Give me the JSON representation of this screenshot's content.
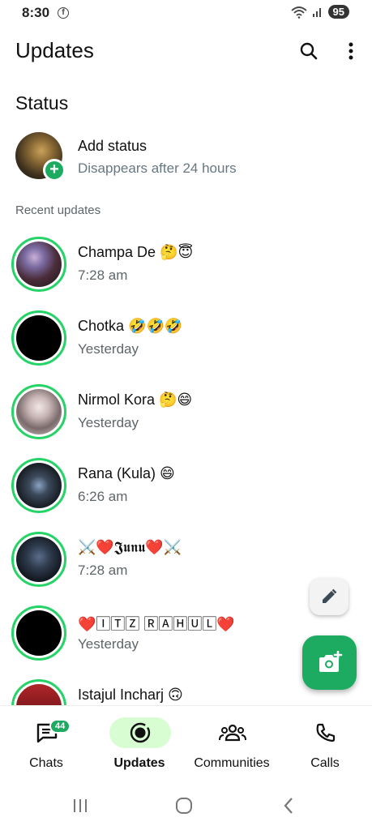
{
  "status_bar": {
    "time": "8:30",
    "app_icon": "facebook-icon",
    "battery": "95"
  },
  "header": {
    "title": "Updates"
  },
  "status_section": {
    "title": "Status",
    "my_status": {
      "title": "Add status",
      "subtitle": "Disappears after 24 hours"
    }
  },
  "recent": {
    "label": "Recent updates",
    "items": [
      {
        "name": "Champa De 🤔😇",
        "time": "7:28 am"
      },
      {
        "name": "Chotka 🤣🤣🤣",
        "time": "Yesterday"
      },
      {
        "name": "Nirmol Kora 🤔😄",
        "time": "Yesterday"
      },
      {
        "name": "Rana (Kula) 😄",
        "time": "6:26 am"
      },
      {
        "name": "⚔️❤️𝕵𝖚𝖓𝖚❤️⚔️",
        "time": "7:28 am"
      },
      {
        "name": "❤️🄸🅃🅉 🅁🄰🄷🅄🄻❤️",
        "time": "Yesterday"
      },
      {
        "name": "Istajul Incharj 🙃",
        "time": ""
      }
    ]
  },
  "nav": {
    "tabs": [
      {
        "label": "Chats",
        "badge": "44"
      },
      {
        "label": "Updates"
      },
      {
        "label": "Communities"
      },
      {
        "label": "Calls"
      }
    ]
  },
  "colors": {
    "accent": "#1daa61",
    "ring": "#25d366",
    "active_pill": "#d8fdd2"
  }
}
